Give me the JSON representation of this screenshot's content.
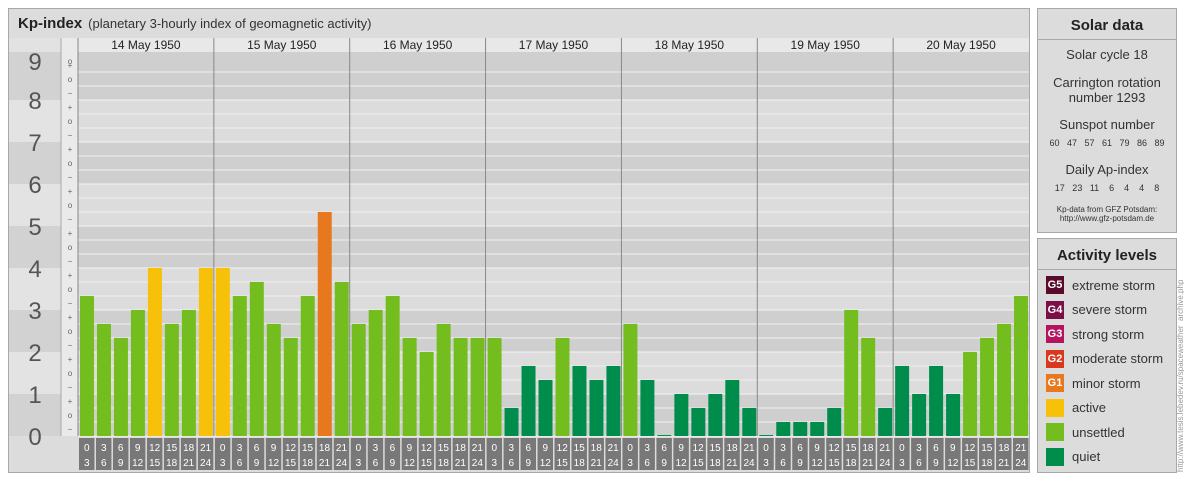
{
  "header": {
    "title": "Kp-index",
    "subtitle": "(planetary 3-hourly index of geomagnetic activity)"
  },
  "solar": {
    "title": "Solar data",
    "cycle": "Solar cycle 18",
    "carrington_1": "Carrington rotation",
    "carrington_2": "number 1293",
    "sunspot_title": "Sunspot number",
    "sunspot_values": "60   47   57   61   79   86   89",
    "ap_title": "Daily Ap-index",
    "ap_values": "17   23   11    6    4    4    8",
    "source_1": "Kp-data from GFZ Potsdam:",
    "source_2": "http://www.gfz-potsdam.de"
  },
  "activity": {
    "title": "Activity levels",
    "levels": [
      {
        "code": "G5",
        "label": "extreme storm",
        "color": "#5a0a2a"
      },
      {
        "code": "G4",
        "label": "severe storm",
        "color": "#7b1048"
      },
      {
        "code": "G3",
        "label": "strong storm",
        "color": "#b3165f"
      },
      {
        "code": "G2",
        "label": "moderate storm",
        "color": "#d9381e"
      },
      {
        "code": "G1",
        "label": "minor storm",
        "color": "#e8781e"
      },
      {
        "code": "",
        "label": "active",
        "color": "#f7c10a"
      },
      {
        "code": "",
        "label": "unsettled",
        "color": "#73be1e"
      },
      {
        "code": "",
        "label": "quiet",
        "color": "#008c4a"
      }
    ]
  },
  "credit": "http://www.tesis.lebedev.ru/spaceweather_archive.php",
  "chart_data": {
    "type": "bar",
    "ylim": [
      0,
      9
    ],
    "y_ticks": [
      "0",
      "1",
      "2",
      "3",
      "4",
      "5",
      "6",
      "7",
      "8",
      "9"
    ],
    "minor_ticks": [
      "+",
      "o",
      "−"
    ],
    "days": [
      "14 May 1950",
      "15 May 1950",
      "16 May 1950",
      "17 May 1950",
      "18 May 1950",
      "19 May 1950",
      "20 May 1950"
    ],
    "hour_labels_top": [
      "0",
      "3",
      "6",
      "9",
      "12",
      "15",
      "18",
      "21"
    ],
    "hour_labels_bottom": [
      "3",
      "6",
      "9",
      "12",
      "15",
      "18",
      "21",
      "24"
    ],
    "colors": {
      "quiet": "#008c4a",
      "unsettled": "#73be1e",
      "active": "#f7c10a",
      "minor_storm": "#e8781e",
      "moderate_storm": "#d9381e",
      "strong_storm": "#b3165f",
      "severe_storm": "#7b1048",
      "extreme_storm": "#5a0a2a"
    },
    "values": [
      3.333,
      2.667,
      2.333,
      3.0,
      4.0,
      2.667,
      3.0,
      4.0,
      4.0,
      3.333,
      3.667,
      2.667,
      2.333,
      3.333,
      5.333,
      3.667,
      2.667,
      3.0,
      3.333,
      2.333,
      2.0,
      2.667,
      2.333,
      2.333,
      2.333,
      0.667,
      1.667,
      1.333,
      2.333,
      1.667,
      1.333,
      1.667,
      2.667,
      1.333,
      0.0,
      1.0,
      0.667,
      1.0,
      1.333,
      0.667,
      0.0,
      0.333,
      0.333,
      0.333,
      0.667,
      3.0,
      2.333,
      0.667,
      1.667,
      1.0,
      1.667,
      1.0,
      2.0,
      2.333,
      2.667,
      3.333
    ]
  }
}
